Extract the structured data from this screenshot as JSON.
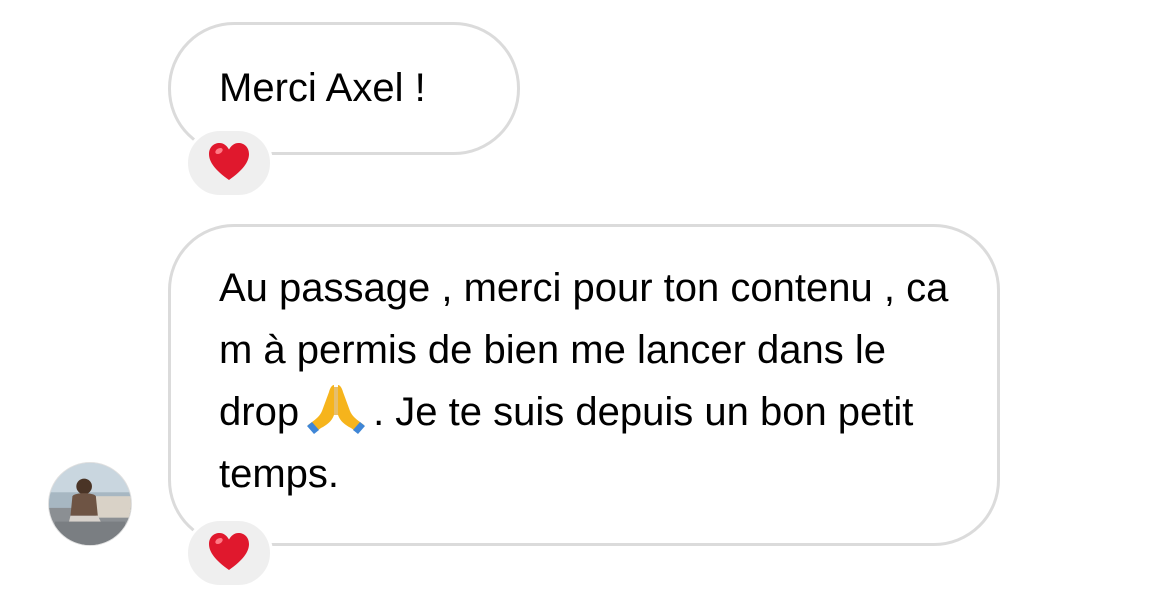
{
  "messages": [
    {
      "text": "Merci Axel !",
      "reaction": "heart-emoji"
    },
    {
      "text_before": "Au passage , merci pour ton contenu , ca m à permis de bien me lancer dans le drop",
      "emoji": "folded-hands-emoji",
      "text_after": ". Je te suis depuis un bon petit temps.",
      "reaction": "heart-emoji"
    }
  ],
  "colors": {
    "bubble_border": "#dbdbdb",
    "reaction_bg": "#efefef",
    "heart": "#e0182d",
    "text": "#000000"
  }
}
